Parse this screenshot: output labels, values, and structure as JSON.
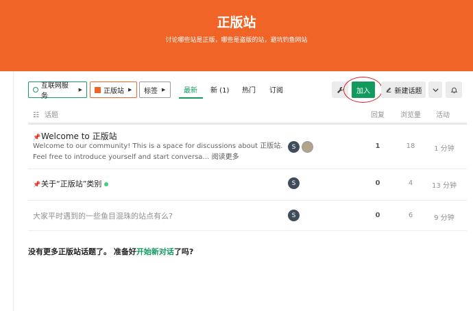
{
  "banner": {
    "title": "正版站",
    "subtitle": "讨论哪些站是正版，哪些是盗版的站，避坑钓鱼网站"
  },
  "nav": {
    "category": "互联网服务",
    "subcategory": "正版站",
    "tags": "标签",
    "tabs": [
      "最新",
      "新 (1)",
      "热门",
      "订阅"
    ],
    "join": "加入",
    "new_topic": "新建话题"
  },
  "table_header": {
    "topic": "话题",
    "replies": "回复",
    "views": "浏览量",
    "activity": "活动"
  },
  "topics": [
    {
      "title": "Welcome to 正版站",
      "excerpt_line1": "Welcome to our community! This is a space for discussions about 正版站.",
      "excerpt_line2": "Feel free to introduce yourself and start conversa…",
      "read_more": "阅读更多",
      "avatar": "S",
      "replies": "1",
      "views": "18",
      "activity": "1 分钟"
    },
    {
      "title": "关于“正版站”类别",
      "avatar": "S",
      "replies": "0",
      "views": "4",
      "activity": "13 分钟"
    },
    {
      "title": "大家平时遇到的一些鱼目混珠的站点有么?",
      "avatar": "S",
      "replies": "0",
      "views": "6",
      "activity": "9 分钟"
    }
  ],
  "footer": {
    "prefix": "没有更多正版站话题了。 准备好",
    "link": "开始新对话",
    "suffix": "了吗?"
  },
  "colors": {
    "brand": "#f06427",
    "accent": "#129a5f"
  }
}
